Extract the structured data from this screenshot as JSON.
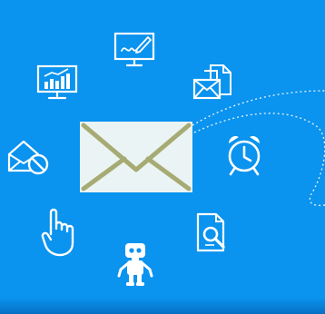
{
  "scene": {
    "background_color": "#0a93ef",
    "icon_stroke_color": "#ffffff",
    "envelope_fill_color": "#eaf4f4",
    "envelope_line_color": "#a7ab73",
    "dotted_path_color": "#ffffff"
  },
  "icons": [
    "monitor-signature-icon",
    "bar-chart-monitor-icon",
    "documents-envelope-icon",
    "envelope-blocked-icon",
    "central-envelope-icon",
    "alarm-clock-icon",
    "pointing-hand-icon",
    "document-search-icon",
    "robot-icon",
    "dotted-flight-path"
  ]
}
